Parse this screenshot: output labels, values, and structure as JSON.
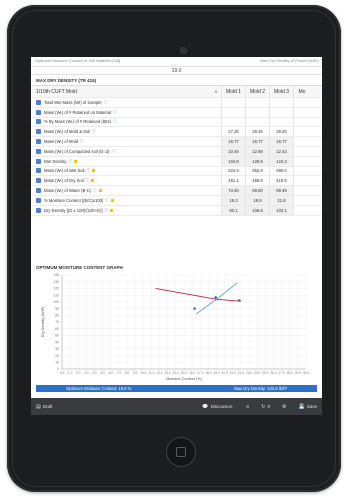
{
  "top": {
    "left_caption": "Optimum Moisture Content of Soil Material [OM]",
    "right_caption": "Max Dry Density of Proctor (MD)",
    "value": "19.0"
  },
  "mdd": {
    "section_title": "MAX DRY DENSITY (TR 415)",
    "mold_select": "1/10th CUFT Mold",
    "columns": [
      "Mold 1",
      "Mold 2",
      "Mold 3",
      "Mo"
    ],
    "rows": [
      {
        "label": "Total Wet Mass (Wt) of Sample",
        "values": [
          "",
          "",
          ""
        ]
      },
      {
        "label": "Mass (Wₜ) of # Retained on Material",
        "values": [
          "",
          "",
          ""
        ]
      },
      {
        "label": "% By Mass (Wₜ) of # Retained (804)",
        "values": [
          "",
          "",
          ""
        ]
      },
      {
        "label": "Mass (Wₜ) of Mold & Soil",
        "values": [
          "27.25",
          "29.45",
          "29.20"
        ]
      },
      {
        "label": "Mass (Wₜ) of Mold",
        "values": [
          "16.77",
          "16.77",
          "16.77"
        ]
      },
      {
        "label": "Mass (Wₜ) of Compacted soil (D=3)",
        "values": [
          "10.48",
          "12.68",
          "12.43"
        ]
      },
      {
        "label": "Wet Density",
        "values": [
          "104.8",
          "126.8",
          "124.3"
        ]
      },
      {
        "label": "Mass (Wₜ) of Wet Soil",
        "values": [
          "524.5",
          "553.9",
          "590.0"
        ]
      },
      {
        "label": "Mass (Wₜ) of Dry Soil",
        "values": [
          "451.1",
          "465.9",
          "410.6"
        ]
      },
      {
        "label": "Mass (Wₜ) of Water (B-C)",
        "values": [
          "73.40",
          "88.00",
          "89.49"
        ]
      },
      {
        "label": "% Moisture Content [(B/C)x100]",
        "values": [
          "16.3",
          "18.9",
          "21.8"
        ]
      },
      {
        "label": "Dry Density [(D x 100)/(100+E)]",
        "values": [
          "90.1",
          "106.6",
          "102.1"
        ]
      }
    ]
  },
  "graph": {
    "title": "OPTIMUM MOISTURE CONTENT GRAPH",
    "y_label": "Dry Density (lb/ft³)",
    "x_label": "Moisture Content (%)"
  },
  "results": {
    "omc": "Optimum Moisture Content: 19.0 %",
    "mdd": "Max Dry Density: 103.8 lb/ft³"
  },
  "toolbar": {
    "draft": "Draft",
    "discussion": "Discussion",
    "count": "0",
    "save": "Save"
  },
  "chart_data": {
    "type": "line",
    "title": "",
    "xlabel": "Moisture Content (%)",
    "ylabel": "Dry Density (lb/ft³)",
    "xlim": [
      0,
      30
    ],
    "ylim": [
      0,
      140
    ],
    "grid": true,
    "series": [
      {
        "name": "",
        "color": "#b5264a",
        "x": [
          11.5,
          19.0,
          22.0
        ],
        "y": [
          120,
          103.8,
          101
        ]
      },
      {
        "name": "",
        "color": "#5b9bd5",
        "x": [
          16.5,
          19.0,
          21.5
        ],
        "y": [
          82,
          103.8,
          128
        ]
      }
    ],
    "points": [
      {
        "x": 16.3,
        "y": 90.1
      },
      {
        "x": 18.9,
        "y": 106.6
      },
      {
        "x": 21.8,
        "y": 102.1
      }
    ]
  }
}
